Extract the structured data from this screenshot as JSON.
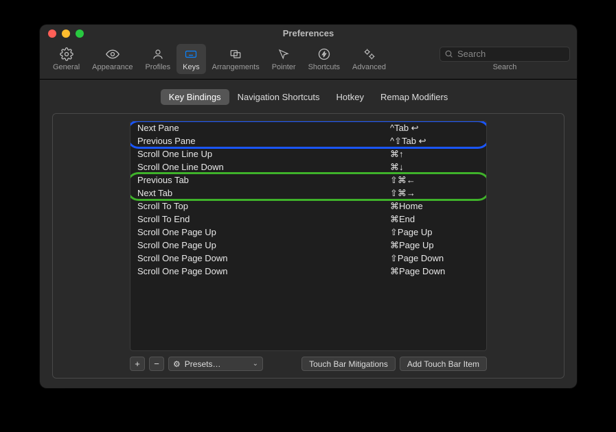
{
  "window": {
    "title": "Preferences"
  },
  "toolbar": {
    "items": [
      {
        "label": "General"
      },
      {
        "label": "Appearance"
      },
      {
        "label": "Profiles"
      },
      {
        "label": "Keys"
      },
      {
        "label": "Arrangements"
      },
      {
        "label": "Pointer"
      },
      {
        "label": "Shortcuts"
      },
      {
        "label": "Advanced"
      }
    ],
    "search_placeholder": "Search",
    "search_label": "Search"
  },
  "tabs": {
    "items": [
      {
        "label": "Key Bindings"
      },
      {
        "label": "Navigation Shortcuts"
      },
      {
        "label": "Hotkey"
      },
      {
        "label": "Remap Modifiers"
      }
    ]
  },
  "bindings": [
    {
      "action": "Next Pane",
      "shortcut": "^Tab ↩"
    },
    {
      "action": "Previous Pane",
      "shortcut": "^⇧Tab ↩"
    },
    {
      "action": "Scroll One Line Up",
      "shortcut": "⌘↑"
    },
    {
      "action": "Scroll One Line Down",
      "shortcut": "⌘↓"
    },
    {
      "action": "Previous Tab",
      "shortcut": "⇧⌘←"
    },
    {
      "action": "Next Tab",
      "shortcut": "⇧⌘→"
    },
    {
      "action": "Scroll To Top",
      "shortcut": "⌘Home"
    },
    {
      "action": "Scroll To End",
      "shortcut": "⌘End"
    },
    {
      "action": "Scroll One Page Up",
      "shortcut": "⇧Page Up"
    },
    {
      "action": "Scroll One Page Up",
      "shortcut": "⌘Page Up"
    },
    {
      "action": "Scroll One Page Down",
      "shortcut": "⇧Page Down"
    },
    {
      "action": "Scroll One Page Down",
      "shortcut": "⌘Page Down"
    }
  ],
  "footer": {
    "add": "+",
    "remove": "−",
    "presets_icon": "⚙",
    "presets_label": "Presets…",
    "touch_mitigations": "Touch Bar Mitigations",
    "add_touch_item": "Add Touch Bar Item"
  },
  "annotations": {
    "blue_color": "#1a56ff",
    "green_color": "#3fb22a"
  }
}
